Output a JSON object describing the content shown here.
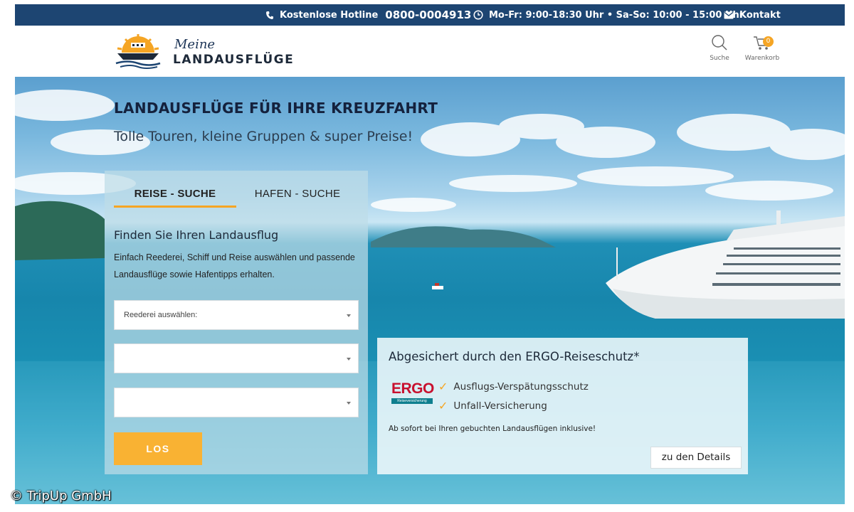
{
  "topbar": {
    "hotline_label": "Kostenlose Hotline",
    "hotline_number": "0800-0004913",
    "hours": "Mo-Fr: 9:00-18:30 Uhr • Sa-So: 10:00 - 15:00 Uhr",
    "contact_label": "Kontakt",
    "bg_color": "#1d4572"
  },
  "header": {
    "logo_script": "Meine",
    "logo_main": "LANDAUSFLÜGE",
    "search_label": "Suche",
    "cart_label": "Warenkorb",
    "cart_count": "0"
  },
  "hero": {
    "title": "LANDAUSFLÜGE FÜR IHRE KREUZFAHRT",
    "subtitle": "Tolle Touren, kleine Gruppen & super Preise!"
  },
  "search_panel": {
    "tabs": [
      {
        "label": "REISE - SUCHE",
        "active": true
      },
      {
        "label": "HAFEN - SUCHE",
        "active": false
      }
    ],
    "title": "Finden Sie Ihren Landausflug",
    "text": "Einfach Reederei, Schiff und Reise auswählen und passende Landausflüge sowie Hafentipps erhalten.",
    "select_shipping_line": "Reederei auswählen:",
    "select_ship": "",
    "select_trip": "",
    "submit_label": "LOS",
    "accent_color": "#f9b233"
  },
  "ergo_box": {
    "title": "Abgesichert durch den ERGO-Reiseschutz*",
    "logo_word": "ERGO",
    "logo_sub": "Reiseversicherung",
    "features": [
      "Ausflugs-Verspätungsschutz",
      "Unfall-Versicherung"
    ],
    "note": "Ab sofort bei Ihren gebuchten Landausflügen inklusive!",
    "details_label": "zu den Details"
  },
  "watermark": "© TripUp GmbH",
  "icons": [
    "phone-icon",
    "clock-icon",
    "mail-icon",
    "ship-logo-icon",
    "search-icon",
    "cart-icon",
    "chevron-down-icon",
    "check-icon"
  ]
}
